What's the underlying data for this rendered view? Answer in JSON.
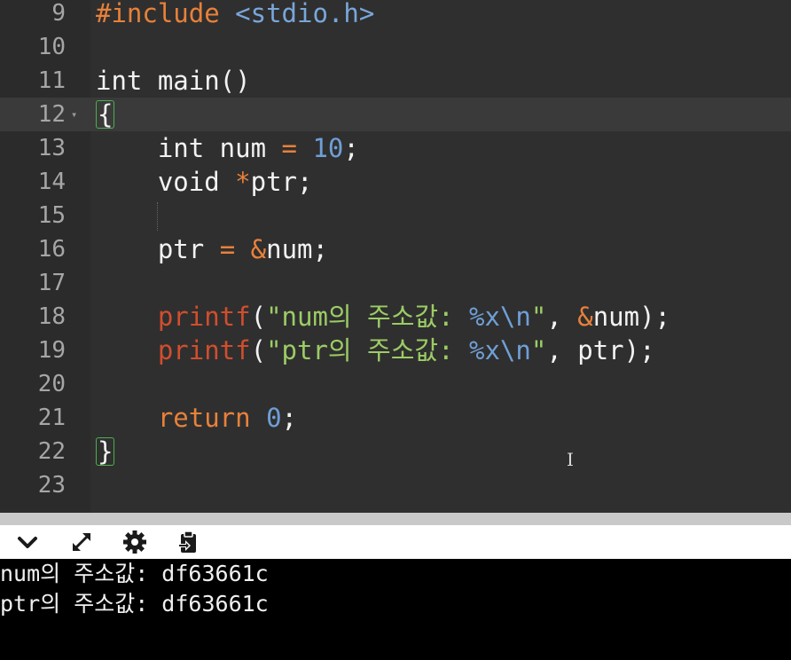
{
  "editor": {
    "lines": [
      {
        "no": "9"
      },
      {
        "no": "10"
      },
      {
        "no": "11"
      },
      {
        "no": "12"
      },
      {
        "no": "13"
      },
      {
        "no": "14"
      },
      {
        "no": "15"
      },
      {
        "no": "16"
      },
      {
        "no": "17"
      },
      {
        "no": "18"
      },
      {
        "no": "19"
      },
      {
        "no": "20"
      },
      {
        "no": "21"
      },
      {
        "no": "22"
      },
      {
        "no": "23"
      }
    ],
    "code": {
      "l9_directive": "#include",
      "l9_header": "<stdio.h>",
      "l11": "int main()",
      "l12_brace": "{",
      "l13_type": "int num",
      "l13_eq": "=",
      "l13_val": "10",
      "l13_end": ";",
      "l14_type": "void",
      "l14_star": "*",
      "l14_rest": "ptr;",
      "l16_var": "ptr",
      "l16_eq": "=",
      "l16_amp": "&",
      "l16_rest": "num;",
      "l18_fn": "printf",
      "l18_open": "(",
      "l18_str": "\"num의 주소값: ",
      "l18_fmt": "%x\\n",
      "l18_strend": "\"",
      "l18_comma": ", ",
      "l18_amp": "&",
      "l18_rest": "num);",
      "l19_fn": "printf",
      "l19_open": "(",
      "l19_str": "\"ptr의 주소값: ",
      "l19_fmt": "%x\\n",
      "l19_strend": "\"",
      "l19_rest": ", ptr);",
      "l21_kw": "return",
      "l21_val": "0",
      "l21_end": ";",
      "l22_brace": "}"
    },
    "active_line": "12"
  },
  "toolbar": {
    "icons": [
      "chevron-down-icon",
      "expand-icon",
      "gear-icon",
      "clipboard-icon"
    ]
  },
  "console": {
    "output": [
      "num의 주소값: df63661c",
      "ptr의 주소값: df63661c"
    ]
  },
  "colors": {
    "editor_bg": "#2f2f2f",
    "keyword_orange": "#e8813a",
    "number_blue": "#6f9fd6",
    "function_red": "#d04e2e",
    "string_green": "#9ccc65",
    "brace_match": "#4caf50"
  }
}
